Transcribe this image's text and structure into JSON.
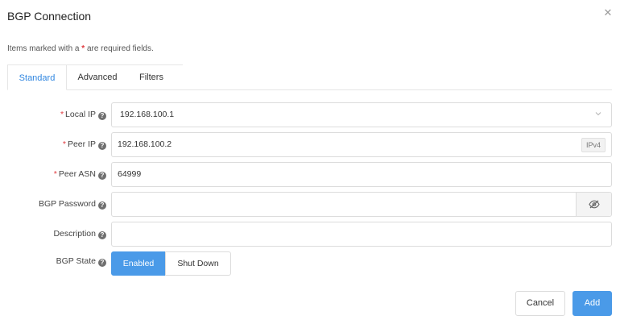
{
  "dialog": {
    "title": "BGP Connection",
    "required_note_prefix": "Items marked with a",
    "required_star": "*",
    "required_note_suffix": "are required fields."
  },
  "tabs": [
    {
      "label": "Standard",
      "active": true
    },
    {
      "label": "Advanced",
      "active": false
    },
    {
      "label": "Filters",
      "active": false
    }
  ],
  "form": {
    "local_ip": {
      "label": "Local IP",
      "required": true,
      "value": "192.168.100.1"
    },
    "peer_ip": {
      "label": "Peer IP",
      "required": true,
      "value": "192.168.100.2",
      "badge": "IPv4"
    },
    "peer_asn": {
      "label": "Peer ASN",
      "required": true,
      "value": "64999"
    },
    "bgp_password": {
      "label": "BGP Password",
      "required": false,
      "value": ""
    },
    "description": {
      "label": "Description",
      "required": false,
      "value": ""
    },
    "bgp_state": {
      "label": "BGP State",
      "options": [
        "Enabled",
        "Shut Down"
      ],
      "selected": "Enabled"
    }
  },
  "footer": {
    "cancel_label": "Cancel",
    "add_label": "Add"
  },
  "colors": {
    "accent": "#4a9ae8",
    "tab_active": "#2f86e0",
    "required": "#e0393e"
  },
  "icons": {
    "close": "close-icon",
    "chevron": "chevron-down-icon",
    "eye": "eye-slash-icon",
    "help": "help-icon"
  }
}
